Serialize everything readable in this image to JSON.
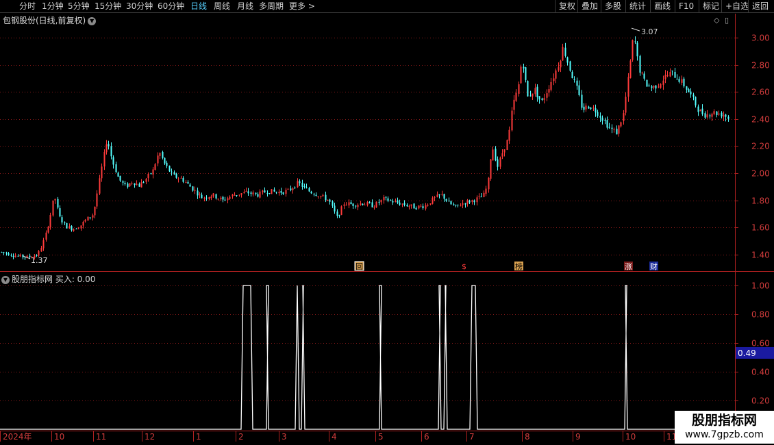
{
  "toolbar": {
    "periods": [
      "分时",
      "1分钟",
      "5分钟",
      "15分钟",
      "30分钟",
      "60分钟",
      "日线",
      "周线",
      "月线",
      "多周期",
      "更多 >"
    ],
    "active_period": "日线",
    "right_buttons": [
      "复权",
      "叠加",
      "多股",
      "统计",
      "画线",
      "F10",
      "标记",
      "+自选",
      "返回"
    ]
  },
  "main_chart": {
    "title": "包钢股份(日线,前复权)",
    "y_ticks": [
      "3.00",
      "2.80",
      "2.60",
      "2.40",
      "2.20",
      "2.00",
      "1.80",
      "1.60",
      "1.40"
    ],
    "high_label": "3.07",
    "low_label": "1.37",
    "event_markers": [
      "回",
      "$",
      "榜",
      "涨",
      "财"
    ]
  },
  "sub_chart": {
    "title": "股朋指标网 买入: 0.00",
    "y_ticks": [
      "1.00",
      "0.80",
      "0.60",
      "0.40",
      "0.20"
    ],
    "cursor_value": "0.49"
  },
  "x_axis": {
    "labels": [
      "2024年",
      "10",
      "11",
      "12",
      "1",
      "2",
      "3",
      "4",
      "5",
      "6",
      "7",
      "8",
      "9",
      "10",
      "11"
    ]
  },
  "watermark": {
    "line1": "股朋指标网",
    "line2": "www.7gpzb.com"
  },
  "colors": {
    "up": "#ff3b3b",
    "down": "#54ffff",
    "accent": "#56d0ff",
    "grid": "#8b1a1a",
    "signal": "#ffffff"
  },
  "chart_data": {
    "type": "candlestick",
    "price_range": [
      1.3,
      3.12
    ],
    "price_path": [
      [
        0,
        1.42
      ],
      [
        10,
        1.41
      ],
      [
        25,
        1.39
      ],
      [
        40,
        1.38
      ],
      [
        55,
        1.4
      ],
      [
        65,
        1.52
      ],
      [
        72,
        1.66
      ],
      [
        79,
        1.84
      ],
      [
        86,
        1.68
      ],
      [
        96,
        1.61
      ],
      [
        106,
        1.59
      ],
      [
        116,
        1.61
      ],
      [
        126,
        1.66
      ],
      [
        136,
        1.7
      ],
      [
        146,
        1.98
      ],
      [
        156,
        2.26
      ],
      [
        163,
        2.1
      ],
      [
        173,
        1.96
      ],
      [
        183,
        1.9
      ],
      [
        193,
        1.94
      ],
      [
        203,
        1.91
      ],
      [
        213,
        1.96
      ],
      [
        223,
        2.02
      ],
      [
        232,
        2.16
      ],
      [
        240,
        2.07
      ],
      [
        252,
        1.98
      ],
      [
        265,
        1.96
      ],
      [
        280,
        1.89
      ],
      [
        295,
        1.82
      ],
      [
        310,
        1.84
      ],
      [
        325,
        1.8
      ],
      [
        340,
        1.84
      ],
      [
        360,
        1.86
      ],
      [
        375,
        1.84
      ],
      [
        390,
        1.87
      ],
      [
        405,
        1.86
      ],
      [
        420,
        1.87
      ],
      [
        435,
        1.93
      ],
      [
        450,
        1.87
      ],
      [
        465,
        1.84
      ],
      [
        480,
        1.8
      ],
      [
        492,
        1.67
      ],
      [
        502,
        1.78
      ],
      [
        515,
        1.77
      ],
      [
        530,
        1.78
      ],
      [
        545,
        1.76
      ],
      [
        560,
        1.81
      ],
      [
        575,
        1.79
      ],
      [
        590,
        1.77
      ],
      [
        605,
        1.75
      ],
      [
        620,
        1.76
      ],
      [
        635,
        1.82
      ],
      [
        645,
        1.84
      ],
      [
        655,
        1.78
      ],
      [
        665,
        1.75
      ],
      [
        675,
        1.78
      ],
      [
        690,
        1.8
      ],
      [
        705,
        1.83
      ],
      [
        712,
        1.92
      ],
      [
        718,
        2.21
      ],
      [
        726,
        2.05
      ],
      [
        735,
        2.18
      ],
      [
        742,
        2.26
      ],
      [
        748,
        2.5
      ],
      [
        756,
        2.62
      ],
      [
        762,
        2.86
      ],
      [
        770,
        2.56
      ],
      [
        780,
        2.62
      ],
      [
        790,
        2.52
      ],
      [
        800,
        2.63
      ],
      [
        810,
        2.74
      ],
      [
        816,
        2.82
      ],
      [
        822,
        2.93
      ],
      [
        832,
        2.76
      ],
      [
        842,
        2.62
      ],
      [
        850,
        2.47
      ],
      [
        860,
        2.5
      ],
      [
        870,
        2.46
      ],
      [
        880,
        2.4
      ],
      [
        890,
        2.33
      ],
      [
        900,
        2.3
      ],
      [
        910,
        2.44
      ],
      [
        918,
        2.74
      ],
      [
        925,
        3.03
      ],
      [
        932,
        2.78
      ],
      [
        942,
        2.66
      ],
      [
        952,
        2.63
      ],
      [
        962,
        2.66
      ],
      [
        970,
        2.71
      ],
      [
        980,
        2.74
      ],
      [
        990,
        2.7
      ],
      [
        1000,
        2.64
      ],
      [
        1010,
        2.56
      ],
      [
        1020,
        2.46
      ],
      [
        1030,
        2.43
      ],
      [
        1040,
        2.45
      ],
      [
        1050,
        2.44
      ],
      [
        1058,
        2.43
      ],
      [
        1064,
        2.4
      ]
    ],
    "buy_signal_pulses": [
      [
        352,
        369
      ],
      [
        389,
        392
      ],
      [
        431,
        437
      ],
      [
        440,
        445
      ],
      [
        554,
        557
      ],
      [
        640,
        644
      ],
      [
        648,
        653
      ],
      [
        686,
        697
      ],
      [
        912,
        916
      ]
    ],
    "buy_signal_range": [
      0,
      1
    ]
  }
}
